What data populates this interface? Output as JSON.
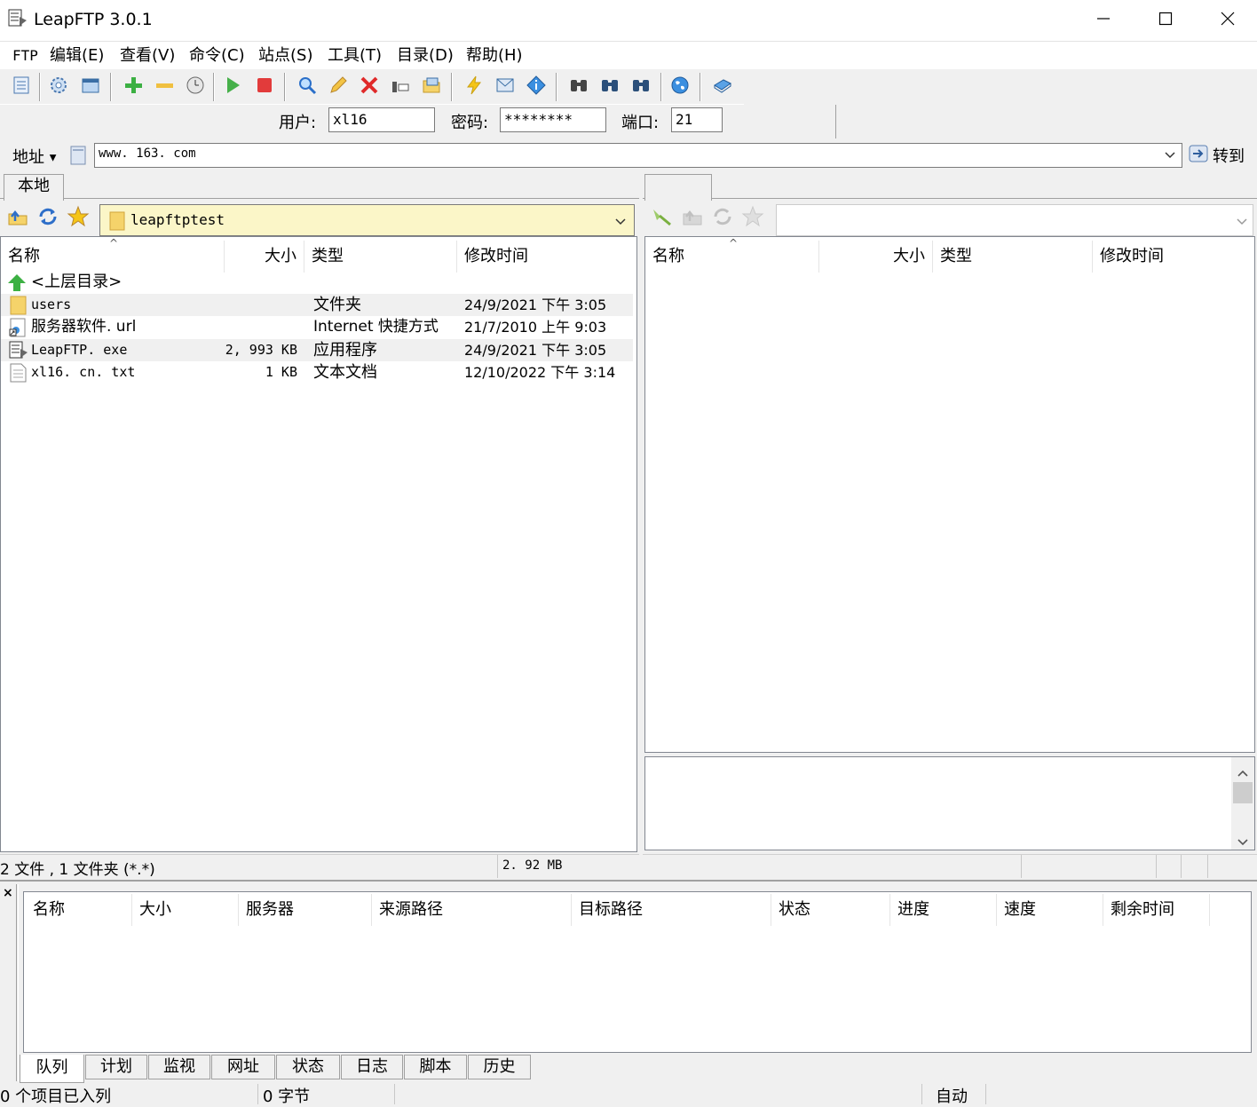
{
  "window": {
    "title": "LeapFTP 3.0.1",
    "controls": [
      "minimize",
      "maximize",
      "close"
    ]
  },
  "menu": {
    "items": [
      "FTP",
      "编辑(E)",
      "查看(V)",
      "命令(C)",
      "站点(S)",
      "工具(T)",
      "目录(D)",
      "帮助(H)"
    ]
  },
  "toolbar": {
    "icons": [
      "site-manager-icon",
      "settings-icon",
      "window-icon",
      "add-icon",
      "remove-icon",
      "clock-icon",
      "play-icon",
      "stop-icon",
      "search-icon",
      "edit-icon",
      "delete-icon",
      "properties-icon",
      "folder-icon",
      "lightning-icon",
      "mail-icon",
      "info-icon",
      "binoculars-icon",
      "binoculars-icon",
      "binoculars-icon",
      "globe-icon",
      "book-icon"
    ]
  },
  "connection": {
    "user_label": "用户:",
    "user_value": "xl16",
    "password_label": "密码:",
    "password_value": "********",
    "port_label": "端口:",
    "port_value": "21"
  },
  "address": {
    "label": "地址",
    "value": "www. 163. com",
    "go_label": "转到"
  },
  "local": {
    "tab": "本地",
    "path": "leapftptest",
    "columns": [
      "名称",
      "大小",
      "类型",
      "修改时间"
    ],
    "parent_label": "<上层目录>",
    "files": [
      {
        "name": "users",
        "size": "",
        "type": "文件夹",
        "modified": "24/9/2021 下午 3:05",
        "icon": "folder-icon"
      },
      {
        "name": "服务器软件. url",
        "size": "",
        "type": "Internet 快捷方式",
        "modified": "21/7/2010 上午 9:03",
        "icon": "shortcut-icon"
      },
      {
        "name": "LeapFTP. exe",
        "size": "2, 993 KB",
        "type": "应用程序",
        "modified": "24/9/2021 下午 3:05",
        "icon": "app-icon"
      },
      {
        "name": "xl16. cn. txt",
        "size": "1 KB",
        "type": "文本文档",
        "modified": "12/10/2022 下午 3:14",
        "icon": "text-file-icon"
      }
    ],
    "status_left": "2 文件 , 1 文件夹 (*.*)",
    "status_right": "2. 92 MB"
  },
  "remote": {
    "tab": "",
    "path": "",
    "columns": [
      "名称",
      "大小",
      "类型",
      "修改时间"
    ]
  },
  "queue": {
    "columns": [
      "名称",
      "大小",
      "服务器",
      "来源路径",
      "目标路径",
      "状态",
      "进度",
      "速度",
      "剩余时间"
    ],
    "tabs": [
      "队列",
      "计划",
      "监视",
      "网址",
      "状态",
      "日志",
      "脚本",
      "历史"
    ],
    "active_tab": "队列"
  },
  "statusbar": {
    "items_queued": "0 个项目已入列",
    "bytes": "0 字节",
    "mode": "自动"
  }
}
